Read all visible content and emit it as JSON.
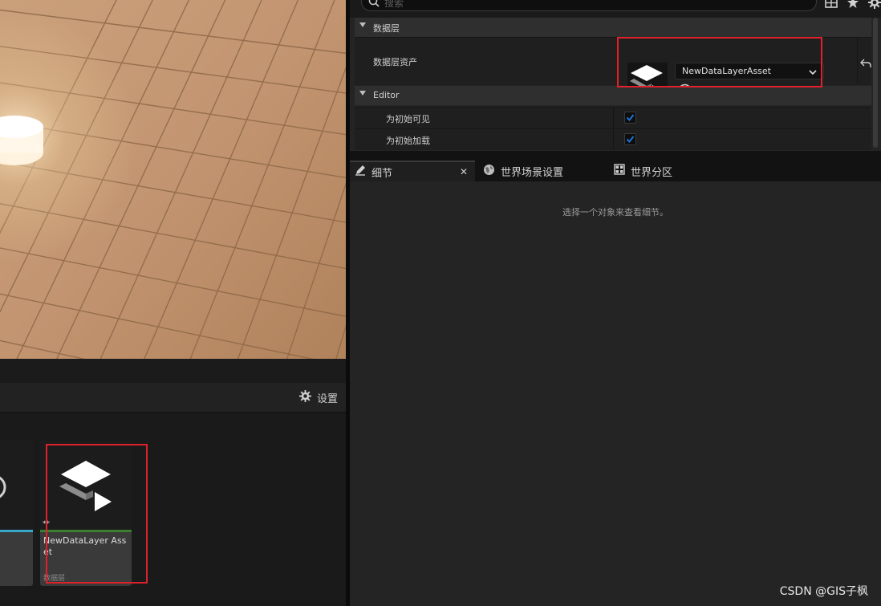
{
  "search": {
    "placeholder": "搜索"
  },
  "data_layer": {
    "section_title": "数据层",
    "asset_label": "数据层资产",
    "asset_value": "NewDataLayerAsset"
  },
  "editor": {
    "section_title": "Editor",
    "initially_visible_label": "为初始可见",
    "initially_loaded_label": "为初始加载",
    "initially_visible": true,
    "initially_loaded": true
  },
  "tabs": [
    {
      "label": "细节",
      "icon": "pencil-icon"
    },
    {
      "label": "世界场景设置",
      "icon": "globe-icon"
    },
    {
      "label": "世界分区",
      "icon": "grid-icon"
    }
  ],
  "details": {
    "empty_message": "选择一个对象来查看细节。"
  },
  "content_browser": {
    "settings_label": "设置",
    "asset_name": "NewDataLayer Asset",
    "asset_type": "数据层",
    "dirty_marker": "**"
  },
  "watermark": "CSDN @GIS子枫",
  "colors": {
    "accent_blue": "#39a7c9",
    "asset_green": "#3d7f31",
    "highlight_red": "#e0202a",
    "checkbox_blue": "#1c74d6"
  }
}
